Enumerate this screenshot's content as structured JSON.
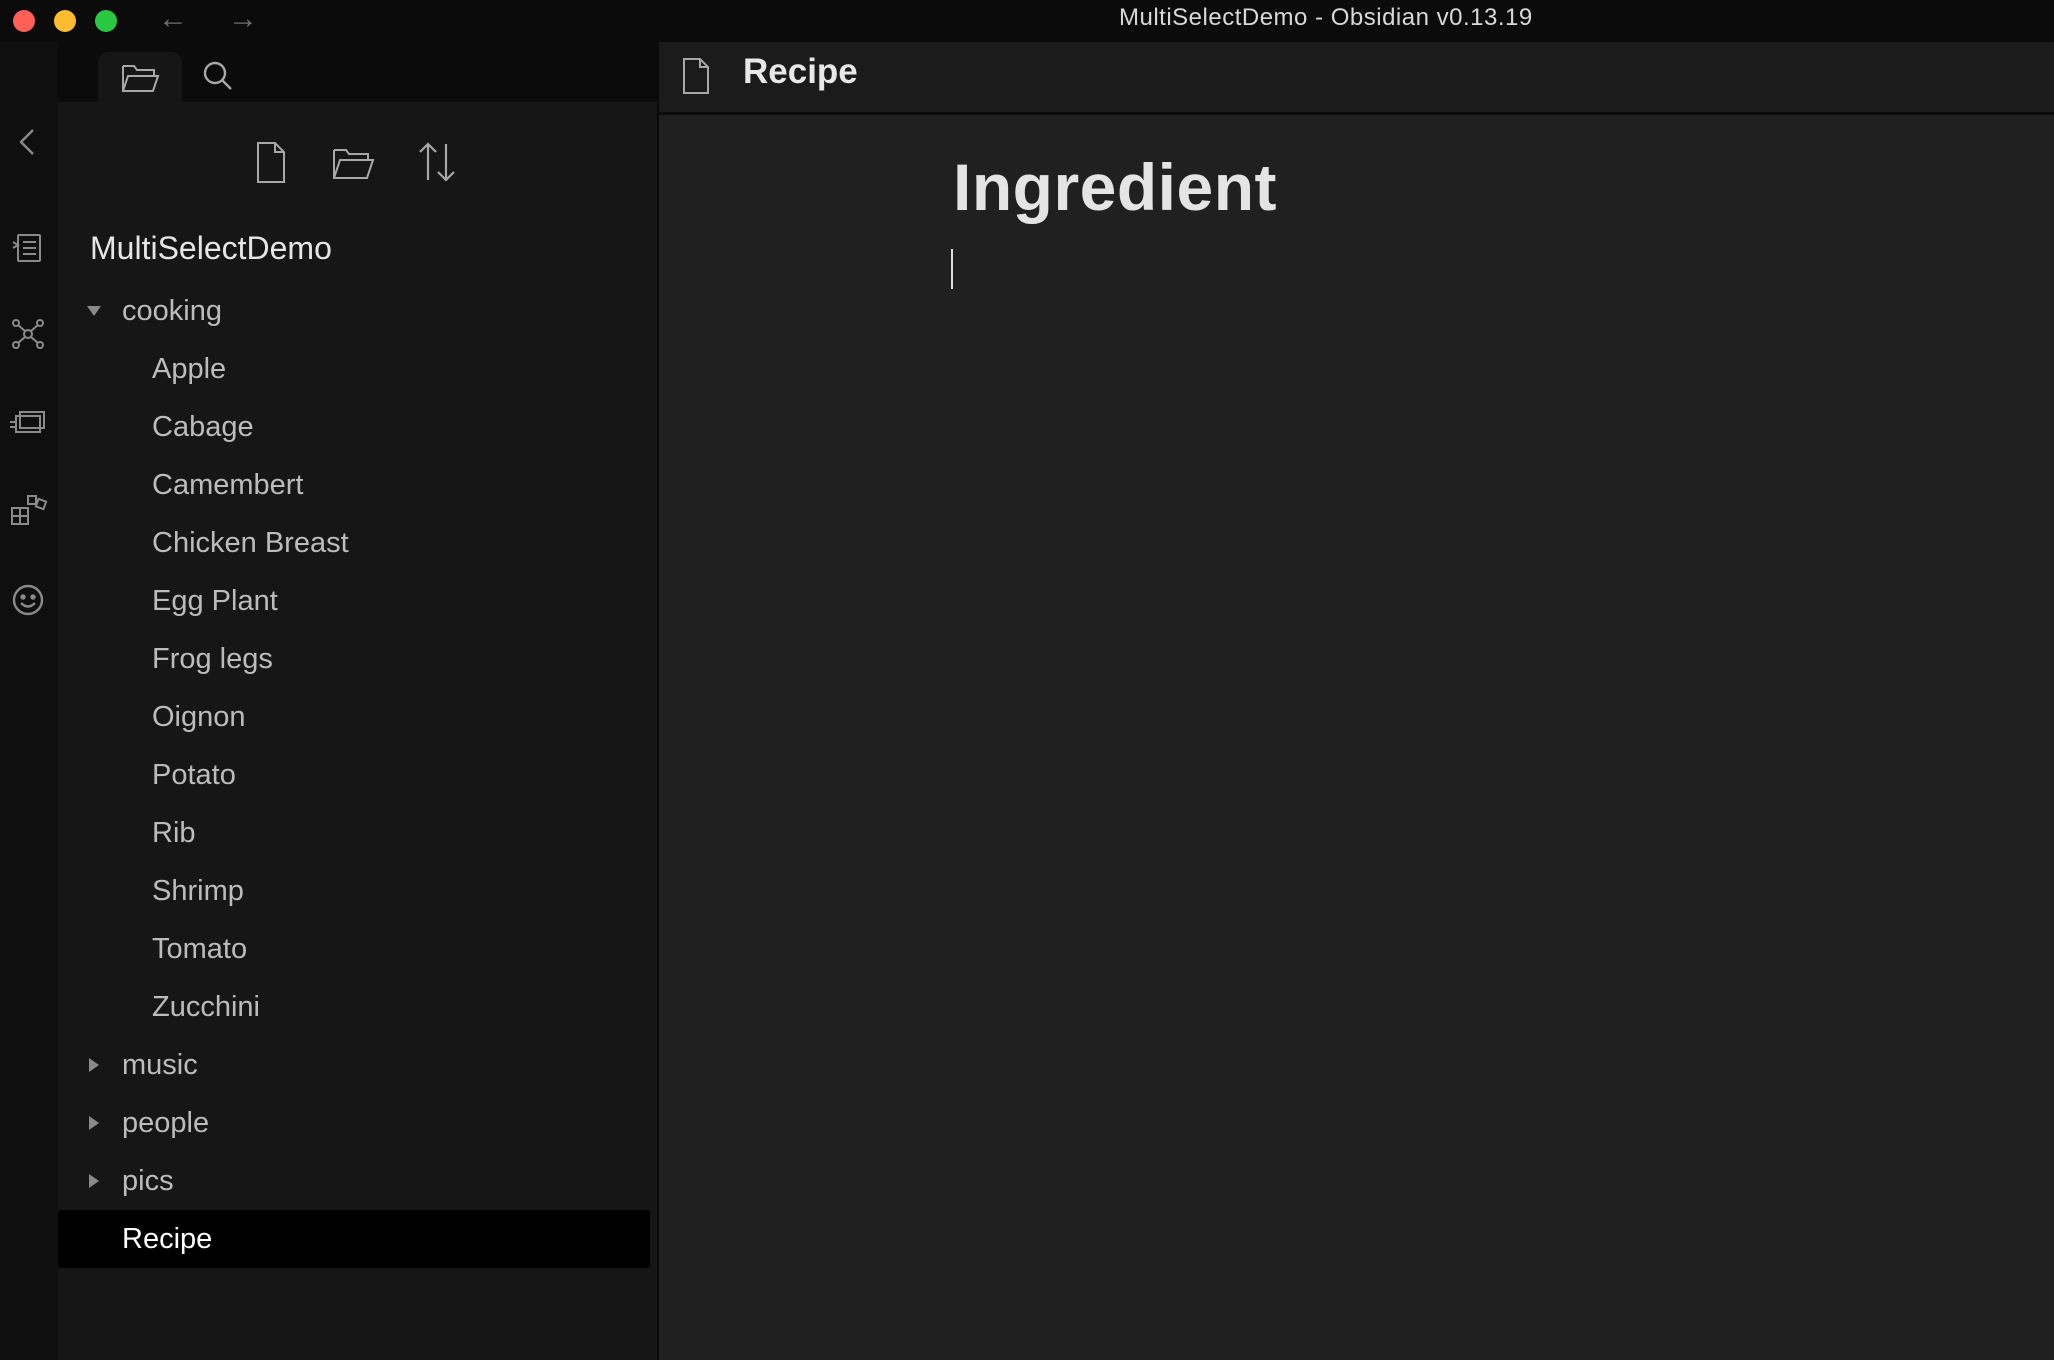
{
  "window": {
    "title": "MultiSelectDemo - Obsidian v0.13.19"
  },
  "nav": {
    "back_icon": "arrow-left-icon",
    "forward_icon": "arrow-right-icon"
  },
  "ribbon": {
    "icons": [
      "collapse-chevron-icon",
      "command-palette-icon",
      "graph-view-icon",
      "slides-icon",
      "plugins-icon",
      "emoji-icon"
    ]
  },
  "sidebar": {
    "tabs": [
      {
        "icon": "folder-icon",
        "active": true
      },
      {
        "icon": "search-icon",
        "active": false
      }
    ],
    "actions": [
      "new-note-icon",
      "new-folder-icon",
      "sort-icon"
    ],
    "vault_name": "MultiSelectDemo",
    "tree": {
      "cooking_folder": "cooking",
      "cooking_files": [
        "Apple",
        "Cabage",
        "Camembert",
        "Chicken Breast",
        "Egg Plant",
        "Frog legs",
        "Oignon",
        "Potato",
        "Rib",
        "Shrimp",
        "Tomato",
        "Zucchini"
      ],
      "music_folder": "music",
      "people_folder": "people",
      "pics_folder": "pics",
      "active_file": "Recipe"
    }
  },
  "editor": {
    "tab_title": "Recipe",
    "heading": "Ingredient"
  },
  "colors": {
    "background": "#1e1e1e",
    "sidebar": "#161616",
    "active_item": "#000000",
    "text": "#dcddde"
  }
}
